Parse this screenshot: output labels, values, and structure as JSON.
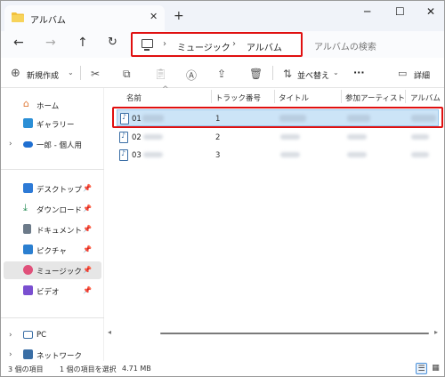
{
  "window": {
    "tab_title": "アルバム",
    "close_tab": "✕",
    "new_tab": "+",
    "minimize": "─",
    "maximize": "☐",
    "close": "✕"
  },
  "nav": {
    "back": "←",
    "forward": "→",
    "up": "↑",
    "refresh": "↻",
    "breadcrumb": [
      "ミュージック",
      "アルバム"
    ],
    "separator": "›",
    "search_placeholder": "アルバムの検索"
  },
  "toolbar": {
    "new_label": "新規作成",
    "sort_label": "並べ替え",
    "more": "···",
    "details_label": "詳細",
    "icons": [
      "cut-icon",
      "copy-icon",
      "paste-icon",
      "rename-icon",
      "share-icon",
      "delete-icon"
    ]
  },
  "sidebar": {
    "items": [
      {
        "label": "ホーム",
        "icon": "home-icon",
        "color": "#e07b39"
      },
      {
        "label": "ギャラリー",
        "icon": "gallery-icon",
        "color": "#2b8fd6"
      },
      {
        "label": "一郎 - 個人用",
        "icon": "onedrive-icon",
        "color": "#1f6fd1"
      },
      {
        "label": "デスクトップ",
        "icon": "desktop-icon",
        "color": "#2d7ad6",
        "pinned": "📌"
      },
      {
        "label": "ダウンロード",
        "icon": "download-icon",
        "color": "#1f8a50",
        "pinned": "📌"
      },
      {
        "label": "ドキュメント",
        "icon": "documents-icon",
        "color": "#6c7a89",
        "pinned": "📌"
      },
      {
        "label": "ピクチャ",
        "icon": "pictures-icon",
        "color": "#2b7fd0",
        "pinned": "📌"
      },
      {
        "label": "ミュージック",
        "icon": "music-icon",
        "color": "#e0507a",
        "pinned": "📌"
      },
      {
        "label": "ビデオ",
        "icon": "videos-icon",
        "color": "#7a4fd0",
        "pinned": "📌"
      },
      {
        "label": "PC",
        "icon": "pc-icon",
        "color": "#3a6ea5"
      },
      {
        "label": "ネットワーク",
        "icon": "network-icon",
        "color": "#3a6ea5"
      }
    ]
  },
  "columns": [
    "名前",
    "トラック番号",
    "タイトル",
    "参加アーティスト",
    "アルバム"
  ],
  "files": [
    {
      "name": "01",
      "track": "1",
      "selected": true
    },
    {
      "name": "02",
      "track": "2",
      "selected": false
    },
    {
      "name": "03",
      "track": "3",
      "selected": false
    }
  ],
  "status": {
    "item_count": "3 個の項目",
    "selection": "1 個の項目を選択",
    "size": "4.71 MB"
  }
}
